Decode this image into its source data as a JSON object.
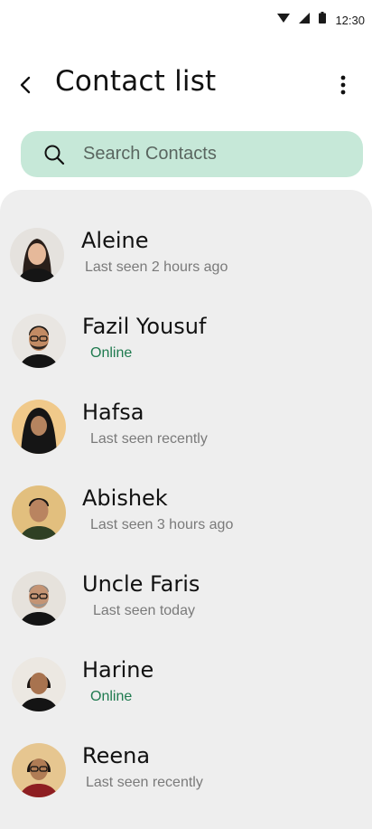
{
  "status_bar": {
    "time": "12:30"
  },
  "header": {
    "title": "Contact list"
  },
  "search": {
    "placeholder": "Search Contacts",
    "value": ""
  },
  "colors": {
    "accent": "#c6e8d8",
    "online": "#1f7a4f",
    "panel": "#eeeeee"
  },
  "contacts": [
    {
      "name": "Aleine",
      "status": "Last seen 2 hours ago",
      "online": false
    },
    {
      "name": "Fazil Yousuf",
      "status": "Online",
      "online": true
    },
    {
      "name": "Hafsa",
      "status": "Last seen recently",
      "online": false
    },
    {
      "name": "Abishek",
      "status": "Last seen 3 hours ago",
      "online": false
    },
    {
      "name": "Uncle Faris",
      "status": "Last seen today",
      "online": false
    },
    {
      "name": "Harine",
      "status": "Online",
      "online": true
    },
    {
      "name": "Reena",
      "status": "Last seen recently",
      "online": false
    }
  ]
}
